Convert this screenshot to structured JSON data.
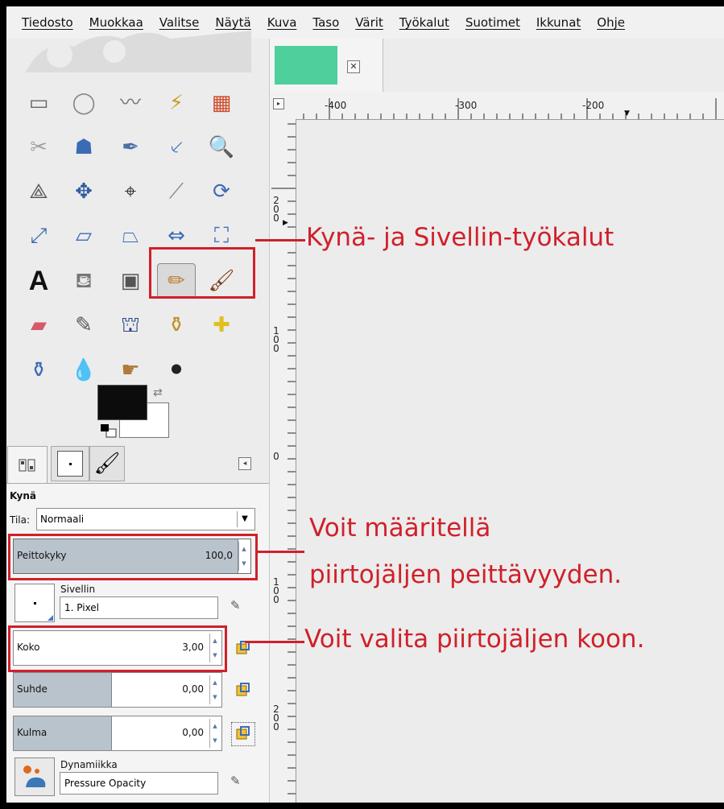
{
  "menubar": {
    "items": [
      "Tiedosto",
      "Muokkaa",
      "Valitse",
      "Näytä",
      "Kuva",
      "Taso",
      "Värit",
      "Työkalut",
      "Suotimet",
      "Ikkunat",
      "Ohje"
    ]
  },
  "toolbox": {
    "tools": [
      {
        "name": "rect-select",
        "glyph": "▭"
      },
      {
        "name": "ellipse-select",
        "glyph": "◯"
      },
      {
        "name": "free-select",
        "glyph": "〰"
      },
      {
        "name": "fuzzy-select",
        "glyph": "⚡"
      },
      {
        "name": "color-select",
        "glyph": "▦"
      },
      {
        "name": "scissors-select",
        "glyph": "✂"
      },
      {
        "name": "foreground-select",
        "glyph": "☗"
      },
      {
        "name": "paths",
        "glyph": "✒"
      },
      {
        "name": "color-picker",
        "glyph": "⸔"
      },
      {
        "name": "zoom",
        "glyph": "🔍"
      },
      {
        "name": "measure",
        "glyph": "⟁"
      },
      {
        "name": "move",
        "glyph": "✥"
      },
      {
        "name": "align",
        "glyph": "⌖"
      },
      {
        "name": "crop",
        "glyph": "⟋"
      },
      {
        "name": "rotate",
        "glyph": "⟳"
      },
      {
        "name": "scale",
        "glyph": "⤢"
      },
      {
        "name": "shear",
        "glyph": "▱"
      },
      {
        "name": "perspective",
        "glyph": "⏢"
      },
      {
        "name": "flip",
        "glyph": "⇔"
      },
      {
        "name": "cage-transform",
        "glyph": "⛶"
      },
      {
        "name": "text",
        "glyph": "A"
      },
      {
        "name": "bucket-fill",
        "glyph": "⛾"
      },
      {
        "name": "blend",
        "glyph": "▣"
      },
      {
        "name": "pencil",
        "glyph": "✏"
      },
      {
        "name": "paintbrush",
        "glyph": "🖌"
      },
      {
        "name": "eraser",
        "glyph": "▰"
      },
      {
        "name": "airbrush",
        "glyph": "✎"
      },
      {
        "name": "ink",
        "glyph": "⛫"
      },
      {
        "name": "clone",
        "glyph": "⚱"
      },
      {
        "name": "heal",
        "glyph": "✚"
      },
      {
        "name": "perspective-clone",
        "glyph": "⚱"
      },
      {
        "name": "blur-sharpen",
        "glyph": "💧"
      },
      {
        "name": "smudge",
        "glyph": "☛"
      },
      {
        "name": "dodge-burn",
        "glyph": "⚫"
      }
    ]
  },
  "options": {
    "title": "Kynä",
    "mode_label": "Tila:",
    "mode_value": "Normaali",
    "opacity_label": "Peittokyky",
    "opacity_value": "100,0",
    "opacity_fraction": 1.0,
    "brush_label": "Sivellin",
    "brush_value": "1. Pixel",
    "size_label": "Koko",
    "size_value": "3,00",
    "size_fraction": 0.0,
    "aspect_label": "Suhde",
    "aspect_value": "0,00",
    "aspect_fraction": 0.5,
    "angle_label": "Kulma",
    "angle_value": "0,00",
    "angle_fraction": 0.5,
    "dynamics_label": "Dynamiikka",
    "dynamics_value": "Pressure Opacity"
  },
  "ruler": {
    "h_labels": [
      "-400",
      "-300",
      "-200"
    ],
    "v_labels": [
      "200",
      "100",
      "0",
      "100",
      "200"
    ]
  },
  "annotations": {
    "tools": "Kynä- ja Sivellin-työkalut",
    "opacity_1": "Voit määritellä",
    "opacity_2": "piirtojäljen peittävyyden.",
    "size": "Voit valita piirtojäljen koon."
  },
  "colors": {
    "annotation": "#d0202a",
    "foreground": "#0c0c0c",
    "background": "#ffffff",
    "thumbnail": "#4fcf9c"
  }
}
